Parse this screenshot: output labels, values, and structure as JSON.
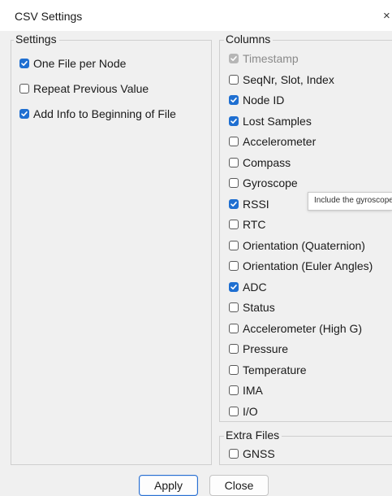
{
  "window": {
    "title": "CSV Settings",
    "close_glyph": "×"
  },
  "settings": {
    "label": "Settings",
    "items": [
      {
        "label": "One File per Node",
        "checked": true
      },
      {
        "label": "Repeat Previous Value",
        "checked": false
      },
      {
        "label": "Add Info to Beginning of File",
        "checked": true
      }
    ]
  },
  "columns": {
    "label": "Columns",
    "items": [
      {
        "label": "Timestamp",
        "checked": true,
        "disabled": true
      },
      {
        "label": "SeqNr, Slot, Index",
        "checked": false
      },
      {
        "label": "Node ID",
        "checked": true
      },
      {
        "label": "Lost Samples",
        "checked": true
      },
      {
        "label": "Accelerometer",
        "checked": false
      },
      {
        "label": "Compass",
        "checked": false
      },
      {
        "label": "Gyroscope",
        "checked": false
      },
      {
        "label": "RSSI",
        "checked": true
      },
      {
        "label": "RTC",
        "checked": false
      },
      {
        "label": "Orientation (Quaternion)",
        "checked": false
      },
      {
        "label": "Orientation (Euler Angles)",
        "checked": false
      },
      {
        "label": "ADC",
        "checked": true
      },
      {
        "label": "Status",
        "checked": false
      },
      {
        "label": "Accelerometer (High G)",
        "checked": false
      },
      {
        "label": "Pressure",
        "checked": false
      },
      {
        "label": "Temperature",
        "checked": false
      },
      {
        "label": "IMA",
        "checked": false
      },
      {
        "label": "I/O",
        "checked": false
      }
    ]
  },
  "extra_files": {
    "label": "Extra Files",
    "items": [
      {
        "label": "GNSS",
        "checked": false
      }
    ]
  },
  "tooltip": {
    "text": "Include the gyroscope"
  },
  "buttons": {
    "apply": "Apply",
    "close": "Close"
  },
  "colors": {
    "checkbox_checked": "#1f6fd1",
    "checkbox_disabled": "#b6b6b6",
    "primary_button_border": "#2a6fd0"
  }
}
